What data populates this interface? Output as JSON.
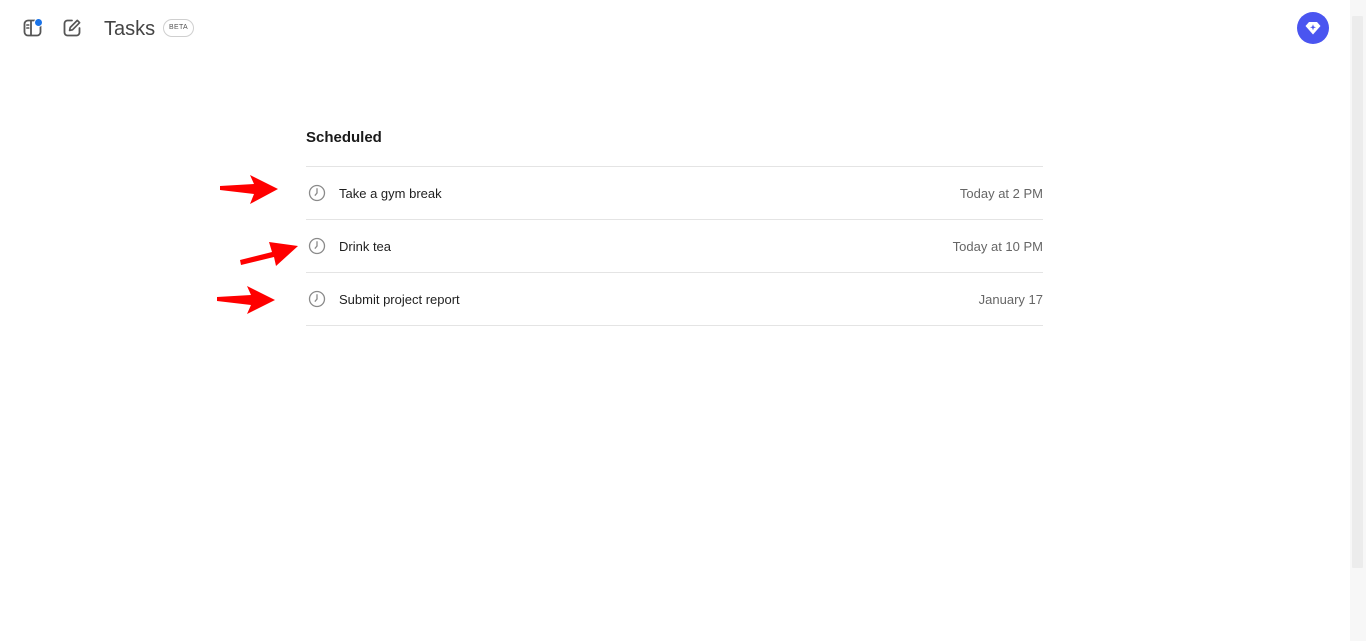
{
  "header": {
    "app_title": "Tasks",
    "badge": "BETA",
    "icons": {
      "sidebar_toggle": "sidebar-toggle-icon",
      "compose": "edit-icon",
      "assistant": "diamond-sparkle-icon"
    },
    "accent_color": "#4a55f0",
    "notification_dot_color": "#1a73e8"
  },
  "main": {
    "section_title": "Scheduled",
    "tasks": [
      {
        "title": "Take a gym break",
        "time": "Today at 2 PM"
      },
      {
        "title": "Drink tea",
        "time": "Today at 10 PM"
      },
      {
        "title": "Submit project report",
        "time": "January 17"
      }
    ]
  },
  "annotations": {
    "arrow_color": "#ff0000"
  }
}
